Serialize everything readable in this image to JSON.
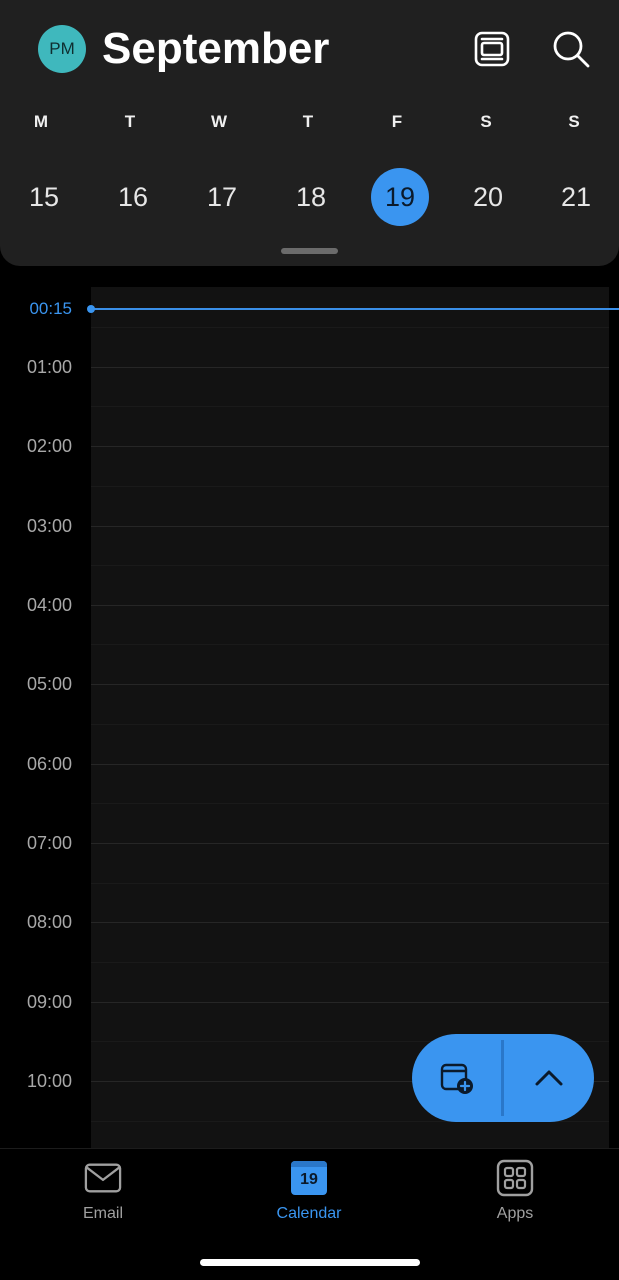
{
  "header": {
    "avatar_initials": "PM",
    "month": "September",
    "weekdays": [
      "M",
      "T",
      "W",
      "T",
      "F",
      "S",
      "S"
    ],
    "days": [
      "15",
      "16",
      "17",
      "18",
      "19",
      "20",
      "21"
    ],
    "selected_day": "19"
  },
  "timeline": {
    "now_label": "00:15",
    "hours": [
      "01:00",
      "02:00",
      "03:00",
      "04:00",
      "05:00",
      "06:00",
      "07:00",
      "08:00",
      "09:00",
      "10:00"
    ]
  },
  "fab": {
    "new_event_icon": "calendar-add-icon",
    "expand_icon": "chevron-up-icon"
  },
  "bottom_nav": {
    "email_label": "Email",
    "calendar_label": "Calendar",
    "calendar_badge": "19",
    "apps_label": "Apps",
    "active": "Calendar"
  },
  "colors": {
    "accent": "#3a95f0",
    "header_bg": "#202020",
    "avatar_bg": "#3fb8bd",
    "background": "#000000"
  }
}
